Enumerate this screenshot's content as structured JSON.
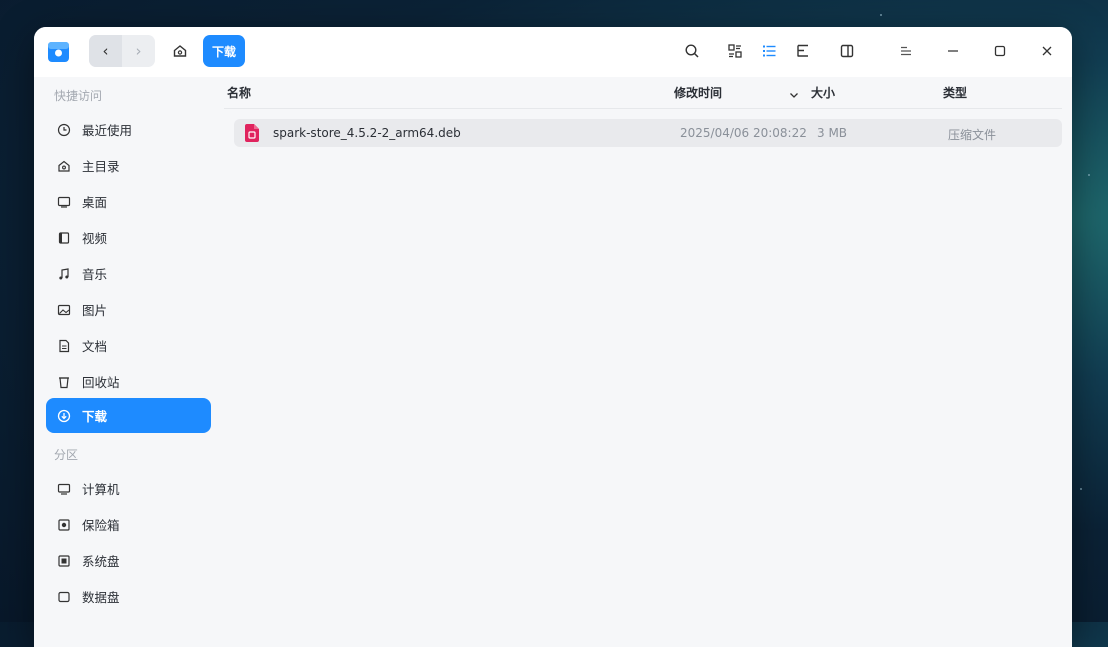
{
  "window": {
    "app_icon": "file-manager-icon",
    "nav": {
      "back": "‹",
      "forward": "›"
    },
    "breadcrumb": "下载",
    "toolbar_icons": [
      "search-icon",
      "tag-icon",
      "list-view-icon",
      "tree-view-icon",
      "detail-panel-icon",
      "menu-icon",
      "minimize-icon",
      "maximize-icon",
      "close-icon"
    ]
  },
  "sidebar": {
    "quick_access_title": "快捷访问",
    "quick_access": [
      {
        "label": "最近使用",
        "icon": "clock-icon"
      },
      {
        "label": "主目录",
        "icon": "home-icon"
      },
      {
        "label": "桌面",
        "icon": "desktop-icon"
      },
      {
        "label": "视频",
        "icon": "video-icon"
      },
      {
        "label": "音乐",
        "icon": "music-icon"
      },
      {
        "label": "图片",
        "icon": "image-icon"
      },
      {
        "label": "文档",
        "icon": "document-icon"
      },
      {
        "label": "回收站",
        "icon": "trash-icon"
      },
      {
        "label": "下载",
        "icon": "download-icon",
        "active": true
      }
    ],
    "partitions_title": "分区",
    "partitions": [
      {
        "label": "计算机",
        "icon": "computer-icon"
      },
      {
        "label": "保险箱",
        "icon": "vault-icon"
      },
      {
        "label": "系统盘",
        "icon": "system-disk-icon"
      },
      {
        "label": "数据盘",
        "icon": "data-disk-icon"
      }
    ]
  },
  "table": {
    "columns": {
      "name": "名称",
      "modified": "修改时间",
      "size": "大小",
      "type": "类型"
    },
    "sort_icon": "chevron-down-icon",
    "rows": [
      {
        "name": "spark-store_4.5.2-2_arm64.deb",
        "modified": "2025/04/06 20:08:22",
        "size": "3 MB",
        "type": "压缩文件",
        "icon": "deb-package-icon"
      }
    ]
  },
  "colors": {
    "accent": "#1e8bff",
    "file_icon": "#e0245e"
  }
}
